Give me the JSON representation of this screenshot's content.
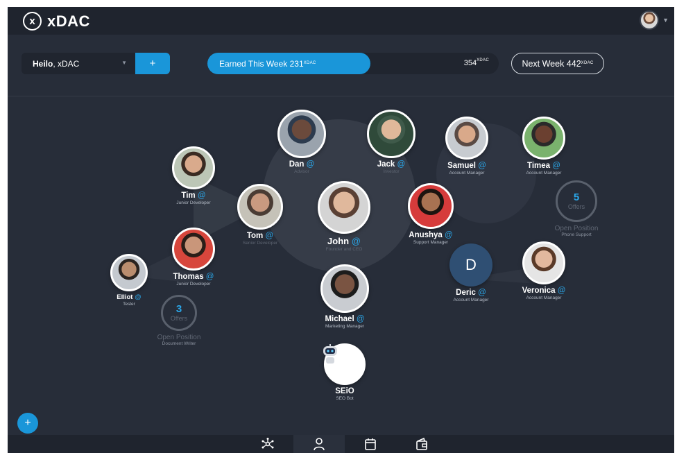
{
  "brand": {
    "name": "xDAC",
    "mark": "x"
  },
  "header": {
    "avatar_icon": "user-avatar-icon"
  },
  "toolbar": {
    "greeting_bold": "Heilo",
    "greeting_rest": ", xDAC",
    "add_label": "+",
    "earned_label": "Earned This Week 231",
    "earned_unit": "XDAC",
    "earned_progress": 0.56,
    "total_value": "354",
    "total_unit": "XDAC",
    "next_week_label": "Next Week 442",
    "next_week_unit": "XDAC"
  },
  "people": [
    {
      "name": "Dan",
      "role": "Advisor"
    },
    {
      "name": "Jack",
      "role": "Investor"
    },
    {
      "name": "Samuel",
      "role": "Account Manager"
    },
    {
      "name": "Timea",
      "role": "Account Manager"
    },
    {
      "name": "Tim",
      "role": "Junior Developer"
    },
    {
      "name": "Tom",
      "role": "Senior Developer"
    },
    {
      "name": "John",
      "role": "Founder and CEO"
    },
    {
      "name": "Anushya",
      "role": "Support Manager"
    },
    {
      "name": "Thomas",
      "role": "Junior Developer"
    },
    {
      "name": "Elliot",
      "role": "Tester"
    },
    {
      "name": "Michael",
      "role": "Marketing Manager"
    },
    {
      "name": "Deric",
      "role": "Account Manager",
      "initial": "D"
    },
    {
      "name": "Veronica",
      "role": "Account Manager"
    },
    {
      "name": "SEiO",
      "role": "SEO Bot"
    }
  ],
  "open_positions": [
    {
      "count": "5",
      "label": "Offers",
      "title": "Open Position",
      "subtitle": "Phone Support"
    },
    {
      "count": "3",
      "label": "Offers",
      "title": "Open Position",
      "subtitle": "Document Writer"
    }
  ],
  "at_symbol": "@",
  "fab_label": "+",
  "bottom_nav": [
    {
      "icon": "network-icon"
    },
    {
      "icon": "person-icon"
    },
    {
      "icon": "calendar-icon"
    },
    {
      "icon": "wallet-icon"
    }
  ],
  "colors": {
    "accent": "#1a96d9",
    "background": "#272d39",
    "topbar": "#1f242e",
    "deric_avatar": "#2f4f73"
  }
}
